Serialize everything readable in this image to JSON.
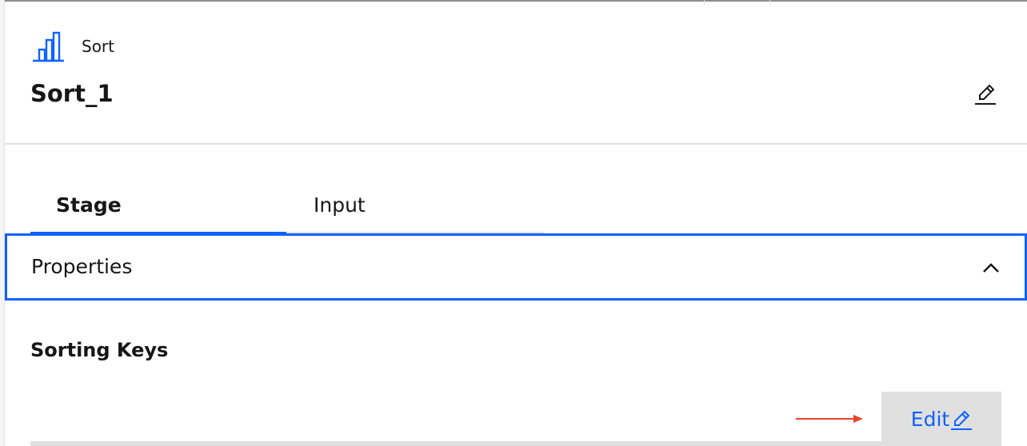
{
  "header": {
    "stage_type_label": "Sort",
    "stage_type_icon": "bar-chart-icon",
    "stage_name": "Sort_1",
    "rename_icon": "pencil-icon"
  },
  "tabs": [
    {
      "label": "Stage",
      "selected": true
    },
    {
      "label": "Input",
      "selected": false
    }
  ],
  "accordion": {
    "title": "Properties",
    "expanded": true,
    "chevron_icon": "chevron-up-icon"
  },
  "sorting_keys": {
    "heading": "Sorting Keys",
    "edit_label": "Edit",
    "edit_icon": "pencil-icon"
  },
  "colors": {
    "accent": "#0f62fe",
    "annotation_arrow": "#e8442a",
    "button_bg": "#e0e0e0",
    "text": "#161616"
  }
}
